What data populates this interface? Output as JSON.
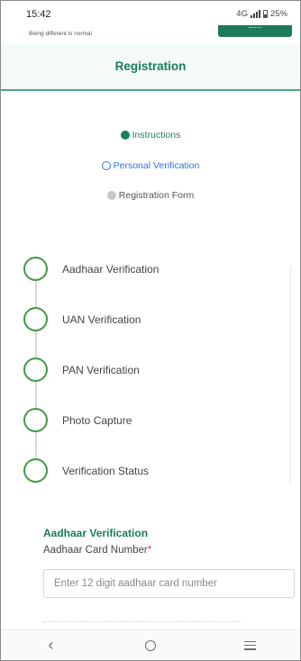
{
  "status_bar": {
    "time": "15:42",
    "network": "4G",
    "battery": "25%"
  },
  "app": {
    "tagline": "Being different is normal"
  },
  "header": {
    "title": "Registration"
  },
  "steps": [
    {
      "label": "Instructions",
      "state": "completed"
    },
    {
      "label": "Personal Verification",
      "state": "active"
    },
    {
      "label": "Registration Form",
      "state": "pending"
    }
  ],
  "verification_steps": [
    {
      "label": "Aadhaar Verification"
    },
    {
      "label": "UAN Verification"
    },
    {
      "label": "PAN Verification"
    },
    {
      "label": "Photo Capture"
    },
    {
      "label": "Verification Status"
    }
  ],
  "form": {
    "section_title": "Aadhaar Verification",
    "field_label": "Aadhaar Card Number",
    "required_mark": "*",
    "placeholder": "Enter 12 digit aadhaar card number"
  },
  "colors": {
    "primary": "#1a7b5c",
    "active_step": "#2f73d8",
    "timeline_circle": "#3f9a3f",
    "required": "#dd3333"
  },
  "icons": {
    "back": "back-arrow-icon",
    "home": "home-circle-icon",
    "recents": "recents-icon"
  }
}
